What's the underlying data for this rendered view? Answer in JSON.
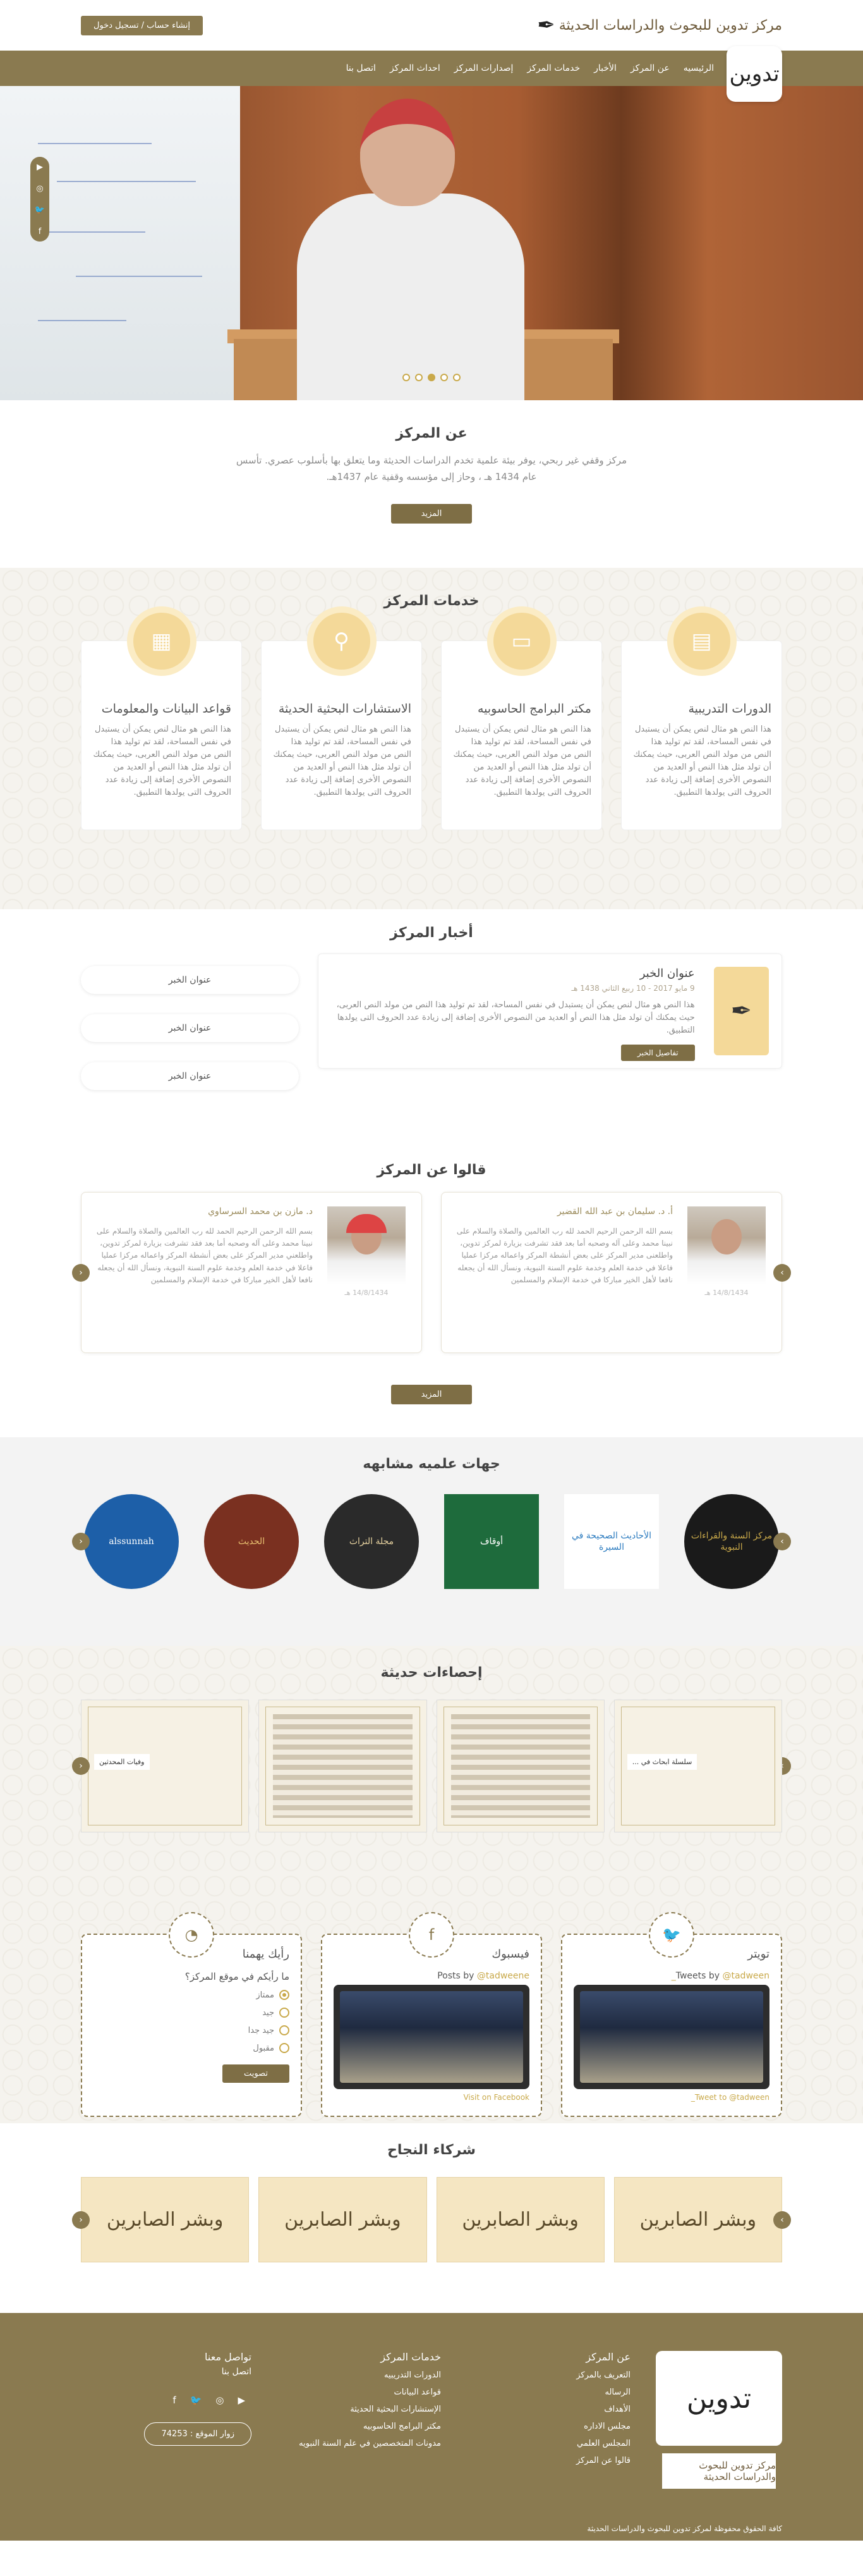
{
  "topbar": {
    "brand": "مركز تدوين للبحوث والدراسات الحديثة",
    "auth": "إنشاء حساب / تسجيل دخول"
  },
  "nav": {
    "items": [
      "الرئيسيه",
      "عن المركز",
      "الأخبار",
      "خدمات المركز",
      "إصدارات المركز",
      "احداث المركز",
      "اتصل بنا"
    ],
    "logo": "تدوين"
  },
  "hero": {
    "slides": 5,
    "active": 3
  },
  "about": {
    "title": "عن المركز",
    "text": "مركز وقفي غير ربحي، يوفر بيئة علمية تخدم الدراسات الحديثة وما يتعلق بها بأسلوب عصري. تأسس عام 1434 هـ ، وحاز إلى مؤسسه وقفية عام 1437هـ.",
    "button": "المزيد"
  },
  "services": {
    "title": "خدمات المركز",
    "cards": [
      {
        "title": "الدورات التدريبية",
        "text": "هذا النص هو مثال لنص يمكن أن يستبدل في نفس المساحة، لقد تم توليد هذا النص من مولد النص العربى، حيث يمكنك أن تولد مثل هذا النص أو العديد من النصوص الأخرى إضافة إلى زيادة عدد الحروف التى يولدها التطبيق.",
        "icon": "presentation-icon"
      },
      {
        "title": "مكتر البرامج الحاسوبيه",
        "text": "هذا النص هو مثال لنص يمكن أن يستبدل في نفس المساحة، لقد تم توليد هذا النص من مولد النص العربى، حيث يمكنك أن تولد مثل هذا النص أو العديد من النصوص الأخرى إضافة إلى زيادة عدد الحروف التى يولدها التطبيق.",
        "icon": "monitor-icon"
      },
      {
        "title": "الاستشارات البحثية الحديثة",
        "text": "هذا النص هو مثال لنص يمكن أن يستبدل في نفس المساحة، لقد تم توليد هذا النص من مولد النص العربى، حيث يمكنك أن تولد مثل هذا النص أو العديد من النصوص الأخرى إضافة إلى زيادة عدد الحروف التى يولدها التطبيق.",
        "icon": "search-icon"
      },
      {
        "title": "قواعد البيانات والمعلومات",
        "text": "هذا النص هو مثال لنص يمكن أن يستبدل في نفس المساحة، لقد تم توليد هذا النص من مولد النص العربى، حيث يمكنك أن تولد مثل هذا النص أو العديد من النصوص الأخرى إضافة إلى زيادة عدد الحروف التى يولدها التطبيق.",
        "icon": "database-icon"
      }
    ]
  },
  "news": {
    "title": "أخبار المركز",
    "feature": {
      "title": "عنوان الخبر",
      "date": "9 مايو 2017 - 10 ربيع الثاني 1438 هـ",
      "text": "هذا النص هو مثال لنص يمكن أن يستبدل في نفس المساحة، لقد تم توليد هذا النص من مولد النص العربى، حيث يمكنك أن تولد مثل هذا النص أو العديد من النصوص الأخرى إضافة إلى زيادة عدد الحروف التى يولدها التطبيق.",
      "button": "تفاصيل الخبر"
    },
    "list": [
      "عنوان الخبر",
      "عنوان الخبر",
      "عنوان الخبر"
    ]
  },
  "testimonials": {
    "title": "قالوا عن المركز",
    "items": [
      {
        "name": "أ. د. سليمان بن عبد الله القضير",
        "text": "بسم الله الرحمن الرحيم الحمد لله رب العالمين والصلاة والسلام على نبينا محمد وعلى آله وصحبه أما بعد فقد تشرفت بزيارة لمركز تدوين، واطلعنى مدير المركز على بعض أنشطة المركز واعماله مركزا عمليا فاعلا في خدمة العلم وخدمة علوم السنة النبوية، ونسأل الله أن يجعله نافعا لأهل الخير مباركا في خدمة الإسلام والمسلمين",
        "date": "14/8/1434 هـ"
      },
      {
        "name": "د. مازن بن محمد السرساوي",
        "text": "بسم الله الرحمن الرحيم الحمد لله رب العالمين والصلاة والسلام على نبينا محمد وعلى آله وصحبه أما بعد فقد تشرفت بزيارة لمركز تدوين، واطلعني مدير المركز على بعض أنشطة المركز واعماله مركزا عمليا فاعلا في خدمة العلم وخدمة علوم السنة النبوية، ونسأل الله أن يجعله نافعا لأهل الخير مباركا في خدمة الإسلام والمسلمين",
        "date": "14/8/1434 هـ"
      }
    ],
    "button": "المزيد"
  },
  "orgs": {
    "title": "جهات علميه مشابهه",
    "items": [
      {
        "label": "مركز السنة والقراءات النبوية",
        "bg": "#1a1a1a",
        "fg": "#c9a94a"
      },
      {
        "label": "الأحاديث الصحيحة في السيرة",
        "bg": "#ffffff",
        "fg": "#2b7bbf"
      },
      {
        "label": "أوقاف",
        "bg": "#1e6b3c",
        "fg": "#ffffff"
      },
      {
        "label": "مجلة التراث",
        "bg": "#2a2a2a",
        "fg": "#e8d3a0"
      },
      {
        "label": "الحديث",
        "bg": "#7a3020",
        "fg": "#e8c070"
      },
      {
        "label": "alssunnah",
        "bg": "#1d5fa8",
        "fg": "#ffffff"
      }
    ]
  },
  "stats": {
    "title": "إحصاءات حديثة",
    "items": [
      {
        "label": "سلسلة ابحاث في ...",
        "kind": "cover"
      },
      {
        "label": "",
        "kind": "table"
      },
      {
        "label": "",
        "kind": "table"
      },
      {
        "label": "وفيات المحدثين",
        "kind": "cover"
      }
    ]
  },
  "widgets": {
    "twitter": {
      "title": "تويتر",
      "by": "Tweets by",
      "handle": "@tadween_",
      "link": "Tweet to @tadween_",
      "icon": "twitter-icon"
    },
    "facebook": {
      "title": "فيسبوك",
      "by": "Posts by",
      "handle": "@tadweene",
      "link": "Visit on Facebook",
      "icon": "facebook-icon"
    },
    "poll": {
      "title": "رأيك يهمنا",
      "question": "ما رأيكم في موقع المركز؟",
      "options": [
        "ممتاز",
        "جيد",
        "جيد جدا",
        "مقبول"
      ],
      "selected": 0,
      "button": "تصويت",
      "icon": "chart-icon"
    }
  },
  "partners": {
    "title": "شركاء النجاح",
    "items": [
      "وبشر الصابرين",
      "وبشر الصابرين",
      "وبشر الصابرين",
      "وبشر الصابرين"
    ]
  },
  "footer": {
    "about": {
      "title": "عن المركز",
      "items": [
        "التعريف بالمركز",
        "الرساله",
        "الأهداف",
        "مجلس الاداره",
        "المجلس العلمي",
        "قالوا عن المركز"
      ]
    },
    "services": {
      "title": "خدمات المركز",
      "items": [
        "الدورات التدريبيه",
        "قواعد البيانات",
        "الإستشارات البحثية الحديثة",
        "مكتر البرامج الحاسوبيه",
        "مدونات المتخصصين في علم السنة النبويه"
      ]
    },
    "contact": {
      "title": "تواصل معنا",
      "sub": "اتصل بنا",
      "visits": "زوار الموقع : 74253"
    },
    "copyright": "كافة الحقوق محفوظة لمركز تدوين للبحوث والدراسات الحديثة"
  }
}
